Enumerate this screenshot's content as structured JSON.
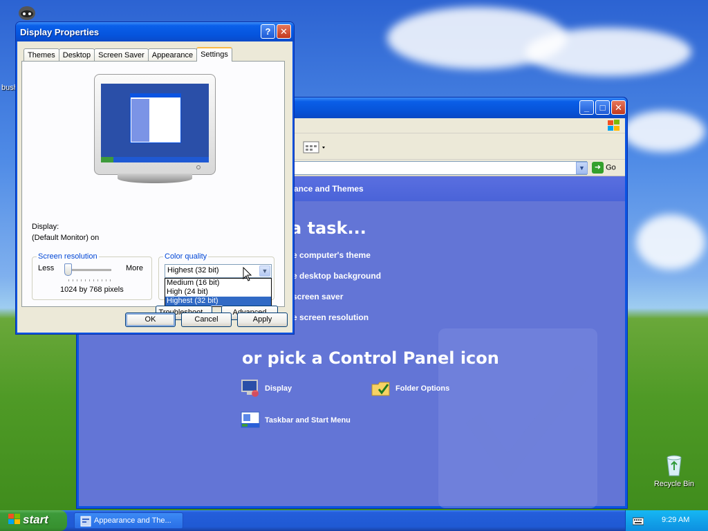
{
  "desktop": {
    "icons": [
      {
        "label": "Recycle Bin"
      }
    ],
    "partial_label_left": "bush"
  },
  "control_panel": {
    "address_go_label": "Go",
    "header_category": "ance and Themes",
    "pick_task_heading": "a task...",
    "tasks": [
      "e computer's theme",
      "e desktop background",
      "screen saver",
      "e screen resolution"
    ],
    "pick_icon_heading": "or pick a Control Panel icon",
    "icons": [
      {
        "label": "Display",
        "icon": "display-icon"
      },
      {
        "label": "Folder Options",
        "icon": "folder-options-icon"
      },
      {
        "label": "Taskbar and Start Menu",
        "icon": "taskbar-icon"
      }
    ]
  },
  "dialog": {
    "title": "Display Properties",
    "help_button": "?",
    "close_button": "✕",
    "tabs": [
      "Themes",
      "Desktop",
      "Screen Saver",
      "Appearance",
      "Settings"
    ],
    "active_tab": "Settings",
    "display_label": "Display:",
    "display_value": "(Default Monitor) on",
    "resolution": {
      "legend": "Screen resolution",
      "less_label": "Less",
      "more_label": "More",
      "value_text": "1024 by 768 pixels",
      "slider_fraction": 0.0
    },
    "color_quality": {
      "legend": "Color quality",
      "selected": "Highest (32 bit)",
      "options": [
        "Medium (16 bit)",
        "High (24 bit)",
        "Highest (32 bit)"
      ],
      "highlighted_index": 2
    },
    "troubleshoot_label": "Troubleshoot...",
    "advanced_label": "Advanced",
    "ok_label": "OK",
    "cancel_label": "Cancel",
    "apply_label": "Apply"
  },
  "taskbar": {
    "start_label": "start",
    "task_label": "Appearance and The...",
    "clock": "9:29 AM"
  },
  "colors": {
    "xp_blue": "#0a54e2",
    "selection_blue": "#316ac5",
    "start_green": "#3d9a3a",
    "tab_highlight": "#f9b944"
  }
}
